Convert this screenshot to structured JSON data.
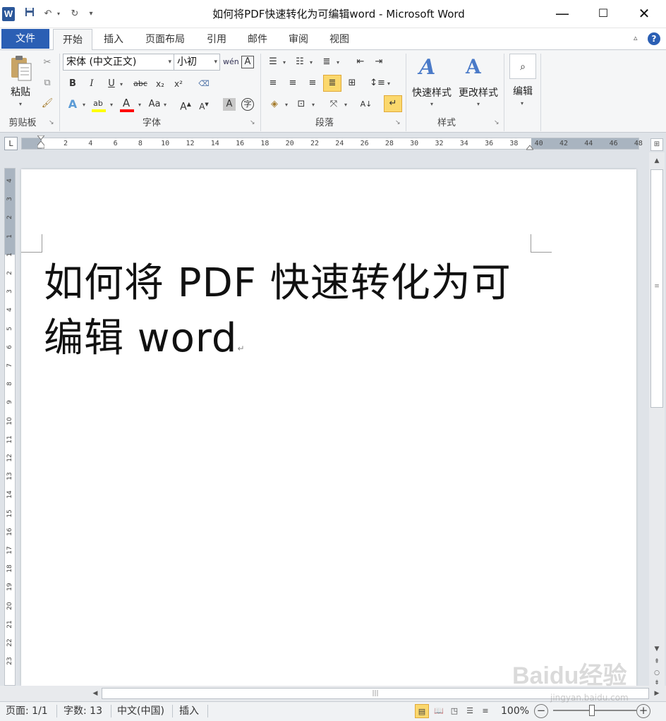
{
  "window": {
    "title": "如何将PDF快速转化为可编辑word - Microsoft Word",
    "app_icon": "word-icon"
  },
  "qat": {
    "save": "save-icon",
    "undo": "undo-icon",
    "redo": "redo-icon",
    "customize": "▾"
  },
  "tabs": [
    {
      "label": "文件"
    },
    {
      "label": "开始"
    },
    {
      "label": "插入"
    },
    {
      "label": "页面布局"
    },
    {
      "label": "引用"
    },
    {
      "label": "邮件"
    },
    {
      "label": "审阅"
    },
    {
      "label": "视图"
    }
  ],
  "ribbon": {
    "clipboard": {
      "label": "剪贴板",
      "paste": "粘贴"
    },
    "font": {
      "label": "字体",
      "font_name": "宋体 (中文正文)",
      "font_size": "小初"
    },
    "paragraph": {
      "label": "段落"
    },
    "styles": {
      "label": "样式",
      "quick_styles": "快速样式",
      "change_styles": "更改样式"
    },
    "editing": {
      "label": "编辑"
    }
  },
  "ruler": {
    "h_ticks": [
      "2",
      "4",
      "6",
      "8",
      "10",
      "12",
      "14",
      "16",
      "18",
      "20",
      "22",
      "24",
      "26",
      "28",
      "30",
      "32",
      "34",
      "36",
      "38",
      "40",
      "42",
      "44",
      "46",
      "48"
    ],
    "v_ticks": [
      "4",
      "3",
      "2",
      "1",
      "1",
      "2",
      "3",
      "4",
      "5",
      "6",
      "7",
      "8",
      "9",
      "10",
      "11",
      "12",
      "13",
      "14",
      "15",
      "16",
      "17",
      "18",
      "19",
      "20",
      "21",
      "22",
      "23"
    ]
  },
  "document": {
    "line1": "如何将 PDF 快速转化为可",
    "line2": "编辑 word",
    "para_mark": "↵"
  },
  "status": {
    "page": "页面: 1/1",
    "words": "字数: 13",
    "language": "中文(中国)",
    "mode": "插入",
    "zoom": "100%"
  },
  "watermark": {
    "text": "Baidu经验",
    "sub": "jingyan.baidu.com"
  },
  "colors": {
    "accent": "#2b5fb4",
    "file_tab": "#2b5fb4",
    "highlight": "#ffff00",
    "font_color": "#ff0000"
  }
}
